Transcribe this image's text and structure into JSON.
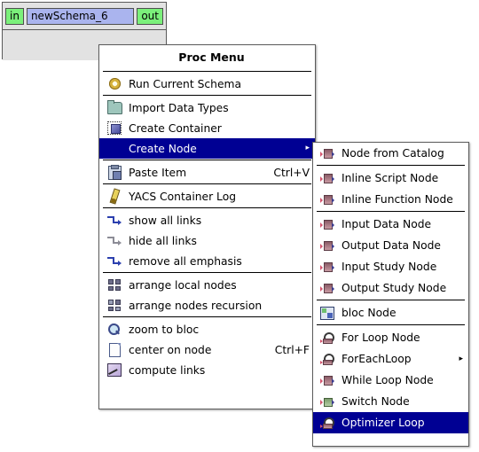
{
  "canvas": {
    "background_color": "#ffffff",
    "schema_node": {
      "in_port_label": "in",
      "title": "newSchema_6",
      "out_port_label": "out",
      "port_color": "#7bf07b",
      "title_color": "#aab4ee",
      "body_color": "#e2e2e2"
    }
  },
  "proc_menu": {
    "title": "Proc Menu",
    "highlight_color": "#000093",
    "items": [
      {
        "id": "run-current-schema",
        "icon": "gear-icon",
        "label": "Run Current Schema",
        "shortcut": "",
        "arrow": false,
        "selected": false,
        "sep_after": true
      },
      {
        "id": "import-data-types",
        "icon": "folder-icon",
        "label": "Import Data Types",
        "shortcut": "",
        "arrow": false,
        "selected": false,
        "sep_after": false
      },
      {
        "id": "create-container",
        "icon": "container-icon",
        "label": "Create Container",
        "shortcut": "",
        "arrow": false,
        "selected": false,
        "sep_after": false
      },
      {
        "id": "create-node",
        "icon": "none-icon",
        "label": "Create Node",
        "shortcut": "",
        "arrow": true,
        "selected": true,
        "sep_after": true
      },
      {
        "id": "paste-item",
        "icon": "clipboard-paste-icon",
        "label": "Paste Item",
        "shortcut": "Ctrl+V",
        "arrow": false,
        "selected": false,
        "sep_after": true
      },
      {
        "id": "yacs-container-log",
        "icon": "pencil-log-icon",
        "label": "YACS Container Log",
        "shortcut": "",
        "arrow": false,
        "selected": false,
        "sep_after": true
      },
      {
        "id": "show-all-links",
        "icon": "link-arrow-blue-icon",
        "label": "show all links",
        "shortcut": "",
        "arrow": false,
        "selected": false,
        "sep_after": false
      },
      {
        "id": "hide-all-links",
        "icon": "link-arrow-gray-icon",
        "label": "hide all links",
        "shortcut": "",
        "arrow": false,
        "selected": false,
        "sep_after": false
      },
      {
        "id": "remove-all-emphasis",
        "icon": "link-arrow-blue-icon",
        "label": "remove all emphasis",
        "shortcut": "",
        "arrow": false,
        "selected": false,
        "sep_after": true
      },
      {
        "id": "arrange-local-nodes",
        "icon": "grid-arrange-icon",
        "label": "arrange local nodes",
        "shortcut": "",
        "arrow": false,
        "selected": false,
        "sep_after": false
      },
      {
        "id": "arrange-nodes-recursion",
        "icon": "grid-recursion-icon",
        "label": "arrange nodes recursion",
        "shortcut": "",
        "arrow": false,
        "selected": false,
        "sep_after": true
      },
      {
        "id": "zoom-to-bloc",
        "icon": "magnifier-icon",
        "label": "zoom to bloc",
        "shortcut": "",
        "arrow": false,
        "selected": false,
        "sep_after": false
      },
      {
        "id": "center-on-node",
        "icon": "page-icon",
        "label": "center on node",
        "shortcut": "Ctrl+F",
        "arrow": false,
        "selected": false,
        "sep_after": false
      },
      {
        "id": "compute-links",
        "icon": "chart-icon",
        "label": "compute links",
        "shortcut": "",
        "arrow": false,
        "selected": false,
        "sep_after": false
      }
    ]
  },
  "create_node_submenu": {
    "highlight_color": "#000093",
    "items": [
      {
        "id": "node-from-catalog",
        "icon": "node-icon",
        "label": "Node from Catalog",
        "arrow": false,
        "selected": false,
        "sep_after": true
      },
      {
        "id": "inline-script-node",
        "icon": "node-icon",
        "label": "Inline Script Node",
        "arrow": false,
        "selected": false,
        "sep_after": false
      },
      {
        "id": "inline-function-node",
        "icon": "node-icon",
        "label": "Inline Function Node",
        "arrow": false,
        "selected": false,
        "sep_after": true
      },
      {
        "id": "input-data-node",
        "icon": "node-icon",
        "label": "Input Data Node",
        "arrow": false,
        "selected": false,
        "sep_after": false
      },
      {
        "id": "output-data-node",
        "icon": "node-icon",
        "label": "Output Data Node",
        "arrow": false,
        "selected": false,
        "sep_after": false
      },
      {
        "id": "input-study-node",
        "icon": "node-icon",
        "label": "Input Study Node",
        "arrow": false,
        "selected": false,
        "sep_after": false
      },
      {
        "id": "output-study-node",
        "icon": "node-icon",
        "label": "Output Study Node",
        "arrow": false,
        "selected": false,
        "sep_after": true
      },
      {
        "id": "bloc-node",
        "icon": "bloc-icon",
        "label": "bloc Node",
        "arrow": false,
        "selected": false,
        "sep_after": true
      },
      {
        "id": "for-loop-node",
        "icon": "loop-icon",
        "label": "For Loop Node",
        "arrow": false,
        "selected": false,
        "sep_after": false
      },
      {
        "id": "foreach-loop",
        "icon": "loop-icon",
        "label": "ForEachLoop",
        "arrow": true,
        "selected": false,
        "sep_after": false
      },
      {
        "id": "while-loop-node",
        "icon": "node-icon",
        "label": "While Loop Node",
        "arrow": false,
        "selected": false,
        "sep_after": false
      },
      {
        "id": "switch-node",
        "icon": "switch-icon",
        "label": "Switch Node",
        "arrow": false,
        "selected": false,
        "sep_after": false
      },
      {
        "id": "optimizer-loop",
        "icon": "loop-icon",
        "label": "Optimizer Loop",
        "arrow": false,
        "selected": true,
        "sep_after": false
      }
    ]
  }
}
